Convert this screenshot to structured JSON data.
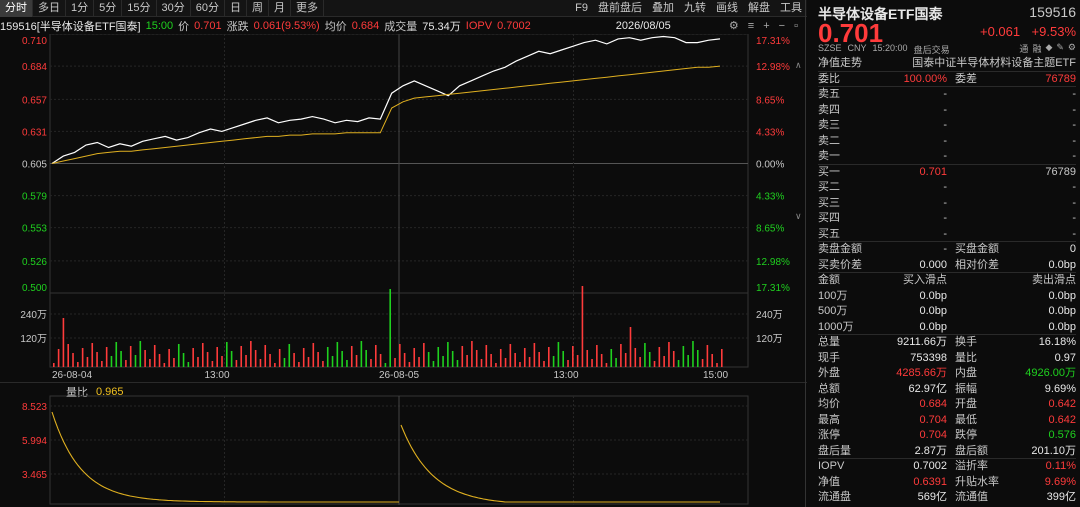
{
  "toolbar": {
    "tabs": [
      "分时",
      "多日",
      "1分",
      "5分",
      "15分",
      "30分",
      "60分",
      "日",
      "周",
      "月",
      "更多"
    ],
    "active_tab": 0,
    "tools": [
      "F9",
      "盘前盘后",
      "叠加",
      "九转",
      "画线",
      "解盘",
      "工具"
    ]
  },
  "infobar": {
    "code_name": "159516[半导体设备ETF国泰]",
    "time": "15:00",
    "price_label": "价",
    "price": "0.701",
    "change_label": "涨跌",
    "change": "0.061(9.53%)",
    "avg_label": "均价",
    "avg": "0.684",
    "volume_label": "成交量",
    "volume": "75.34万",
    "iopv_label": "IOPV",
    "iopv": "0.7002",
    "date": "2026/08/05",
    "icons": [
      "⚙",
      "≡",
      "+",
      "−",
      "▫"
    ]
  },
  "chart_data": {
    "type": "line",
    "price_axis": [
      "0.710",
      "0.684",
      "0.657",
      "0.631",
      "0.605",
      "0.579",
      "0.553",
      "0.526",
      "0.500"
    ],
    "pct_axis": [
      "17.31%",
      "12.98%",
      "8.65%",
      "4.33%",
      "0.00%",
      "4.33%",
      "8.65%",
      "12.98%",
      "17.31%"
    ],
    "ylim": [
      0.5,
      0.71
    ],
    "prev_close": 0.605,
    "volume_axis": [
      "240万",
      "120万"
    ],
    "x_labels": [
      "26-08-04",
      "13:00",
      "26-08-05",
      "13:00",
      "15:00"
    ],
    "series": [
      {
        "name": "价",
        "values": [
          0.605,
          0.611,
          0.614,
          0.62,
          0.622,
          0.618,
          0.621,
          0.619,
          0.623,
          0.625,
          0.627,
          0.624,
          0.626,
          0.63,
          0.633,
          0.631,
          0.634,
          0.637,
          0.64,
          0.642,
          0.638,
          0.64,
          0.641,
          0.643,
          0.641,
          0.638,
          0.64,
          0.639,
          0.642,
          0.641,
          0.662,
          0.668,
          0.672,
          0.668,
          0.664,
          0.66,
          0.668,
          0.672,
          0.676,
          0.68,
          0.683,
          0.688,
          0.692,
          0.696,
          0.694,
          0.697,
          0.7,
          0.703,
          0.705,
          0.702,
          0.706,
          0.707,
          0.705,
          0.707,
          0.708,
          0.707,
          0.703,
          0.703,
          0.705,
          0.706
        ]
      },
      {
        "name": "均价",
        "values": [
          0.605,
          0.607,
          0.609,
          0.611,
          0.613,
          0.614,
          0.615,
          0.615,
          0.616,
          0.617,
          0.618,
          0.619,
          0.62,
          0.621,
          0.622,
          0.623,
          0.624,
          0.625,
          0.626,
          0.627,
          0.627,
          0.628,
          0.628,
          0.629,
          0.629,
          0.629,
          0.63,
          0.63,
          0.63,
          0.63,
          0.65,
          0.655,
          0.658,
          0.659,
          0.66,
          0.661,
          0.662,
          0.663,
          0.664,
          0.665,
          0.666,
          0.667,
          0.668,
          0.669,
          0.67,
          0.671,
          0.672,
          0.673,
          0.674,
          0.675,
          0.676,
          0.677,
          0.678,
          0.679,
          0.68,
          0.681,
          0.682,
          0.683,
          0.683,
          0.684
        ]
      }
    ]
  },
  "sub_chart": {
    "title": "量比",
    "value": "0.965",
    "axis": [
      "8.523",
      "5.994",
      "3.465"
    ]
  },
  "side_marks": [
    "∧",
    "∨"
  ],
  "panel": {
    "title": "半导体设备ETF国泰",
    "code": "159516",
    "price": "0.701",
    "change": "+0.061",
    "pct": "+9.53%",
    "exchange": "SZSE",
    "currency": "CNY",
    "time": "15:20:00",
    "session": "盘后交易",
    "badges": [
      "通",
      "融",
      "◆",
      "✎",
      "⚙"
    ],
    "nav_trend": "净值走势",
    "index_name": "国泰中证半导体材料设备主题ETF",
    "weibi_label": "委比",
    "weibi": "100.00%",
    "weicha_label": "委差",
    "weicha": "76789",
    "sells": [
      {
        "label": "卖五",
        "price": "-",
        "vol": "-"
      },
      {
        "label": "卖四",
        "price": "-",
        "vol": "-"
      },
      {
        "label": "卖三",
        "price": "-",
        "vol": "-"
      },
      {
        "label": "卖二",
        "price": "-",
        "vol": "-"
      },
      {
        "label": "卖一",
        "price": "-",
        "vol": "-"
      }
    ],
    "buys": [
      {
        "label": "买一",
        "price": "0.701",
        "vol": "76789"
      },
      {
        "label": "买二",
        "price": "-",
        "vol": "-"
      },
      {
        "label": "买三",
        "price": "-",
        "vol": "-"
      },
      {
        "label": "买四",
        "price": "-",
        "vol": "-"
      },
      {
        "label": "买五",
        "price": "-",
        "vol": "-"
      }
    ],
    "sell_amt_label": "卖盘金额",
    "sell_amt": "-",
    "buy_amt_label": "买盘金额",
    "buy_amt": "0",
    "sell_spread_label": "买卖价差",
    "sell_spread": "0.000",
    "rel_spread_label": "相对价差",
    "rel_spread": "0.0bp",
    "slip_header": [
      "金额",
      "买入滑点",
      "卖出滑点"
    ],
    "slips": [
      {
        "amt": "100万",
        "buy": "0.0bp",
        "sell": "0.0bp"
      },
      {
        "amt": "500万",
        "buy": "0.0bp",
        "sell": "0.0bp"
      },
      {
        "amt": "1000万",
        "buy": "0.0bp",
        "sell": "0.0bp"
      }
    ],
    "stats": [
      {
        "l1": "总量",
        "v1": "9211.66万",
        "c1": "white",
        "l2": "换手",
        "v2": "16.18%",
        "c2": "white"
      },
      {
        "l1": "现手",
        "v1": "753398",
        "c1": "white",
        "l2": "量比",
        "v2": "0.97",
        "c2": "white"
      },
      {
        "l1": "外盘",
        "v1": "4285.66万",
        "c1": "red",
        "l2": "内盘",
        "v2": "4926.00万",
        "c2": "green"
      },
      {
        "l1": "总额",
        "v1": "62.97亿",
        "c1": "white",
        "l2": "振幅",
        "v2": "9.69%",
        "c2": "white"
      },
      {
        "l1": "均价",
        "v1": "0.684",
        "c1": "red",
        "l2": "开盘",
        "v2": "0.642",
        "c2": "red"
      },
      {
        "l1": "最高",
        "v1": "0.704",
        "c1": "red",
        "l2": "最低",
        "v2": "0.642",
        "c2": "red"
      },
      {
        "l1": "涨停",
        "v1": "0.704",
        "c1": "red",
        "l2": "跌停",
        "v2": "0.576",
        "c2": "green"
      },
      {
        "l1": "盘后量",
        "v1": "2.87万",
        "c1": "white",
        "l2": "盘后额",
        "v2": "201.10万",
        "c2": "white"
      }
    ],
    "stats2": [
      {
        "l1": "IOPV",
        "v1": "0.7002",
        "c1": "white",
        "l2": "溢折率",
        "v2": "0.11%",
        "c2": "red"
      },
      {
        "l1": "净值",
        "v1": "0.6391",
        "c1": "red",
        "l2": "升贴水率",
        "v2": "9.69%",
        "c2": "red"
      },
      {
        "l1": "流通盘",
        "v1": "569亿",
        "c1": "white",
        "l2": "流通值",
        "v2": "399亿",
        "c2": "white"
      }
    ]
  }
}
